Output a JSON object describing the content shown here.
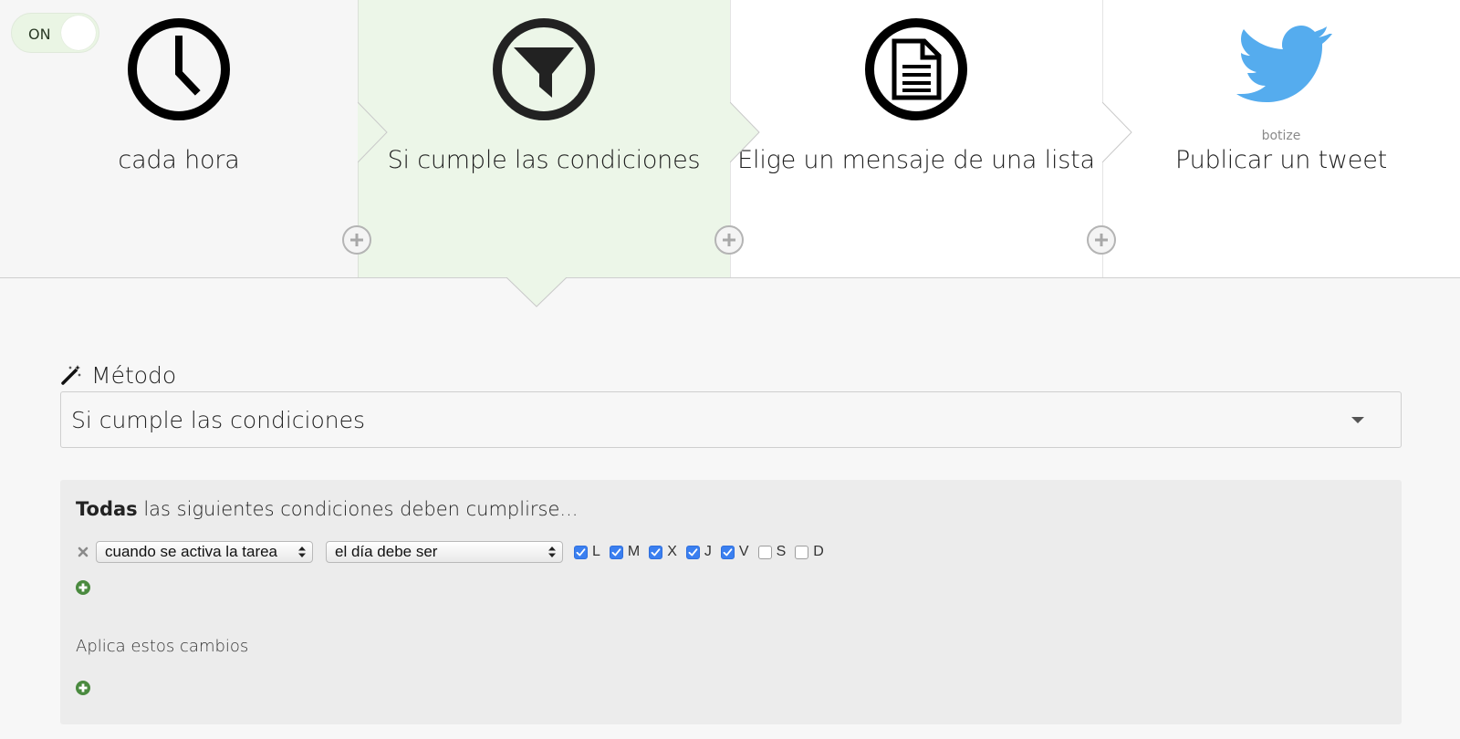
{
  "toggle": {
    "label": "ON",
    "state": "on"
  },
  "steps": [
    {
      "label": "cada hora",
      "icon": "clock-icon",
      "sublabel": ""
    },
    {
      "label": "Si cumple las condiciones",
      "icon": "filter-icon",
      "sublabel": ""
    },
    {
      "label": "Elige un mensaje de una lista",
      "icon": "document-icon",
      "sublabel": ""
    },
    {
      "label": "Publicar un tweet",
      "icon": "twitter-bird-icon",
      "sublabel": "botize"
    }
  ],
  "method": {
    "label": "Método",
    "icon": "magic-wand-icon",
    "selected": "Si cumple las condiciones"
  },
  "conditions": {
    "heading_bold": "Todas",
    "heading_rest": " las siguientes condiciones deben cumplirse...",
    "rows": [
      {
        "field": "cuando se activa la tarea",
        "operator": "el día debe ser",
        "days": [
          {
            "label": "L",
            "checked": true
          },
          {
            "label": "M",
            "checked": true
          },
          {
            "label": "X",
            "checked": true
          },
          {
            "label": "J",
            "checked": true
          },
          {
            "label": "V",
            "checked": true
          },
          {
            "label": "S",
            "checked": false
          },
          {
            "label": "D",
            "checked": false
          }
        ]
      }
    ],
    "apply_label": "Aplica estos cambios"
  },
  "colors": {
    "active_step_bg": "#ecf6e8",
    "twitter_blue": "#55acee",
    "checkbox_blue": "#3a7ff0",
    "add_green": "#4a8a3f"
  }
}
